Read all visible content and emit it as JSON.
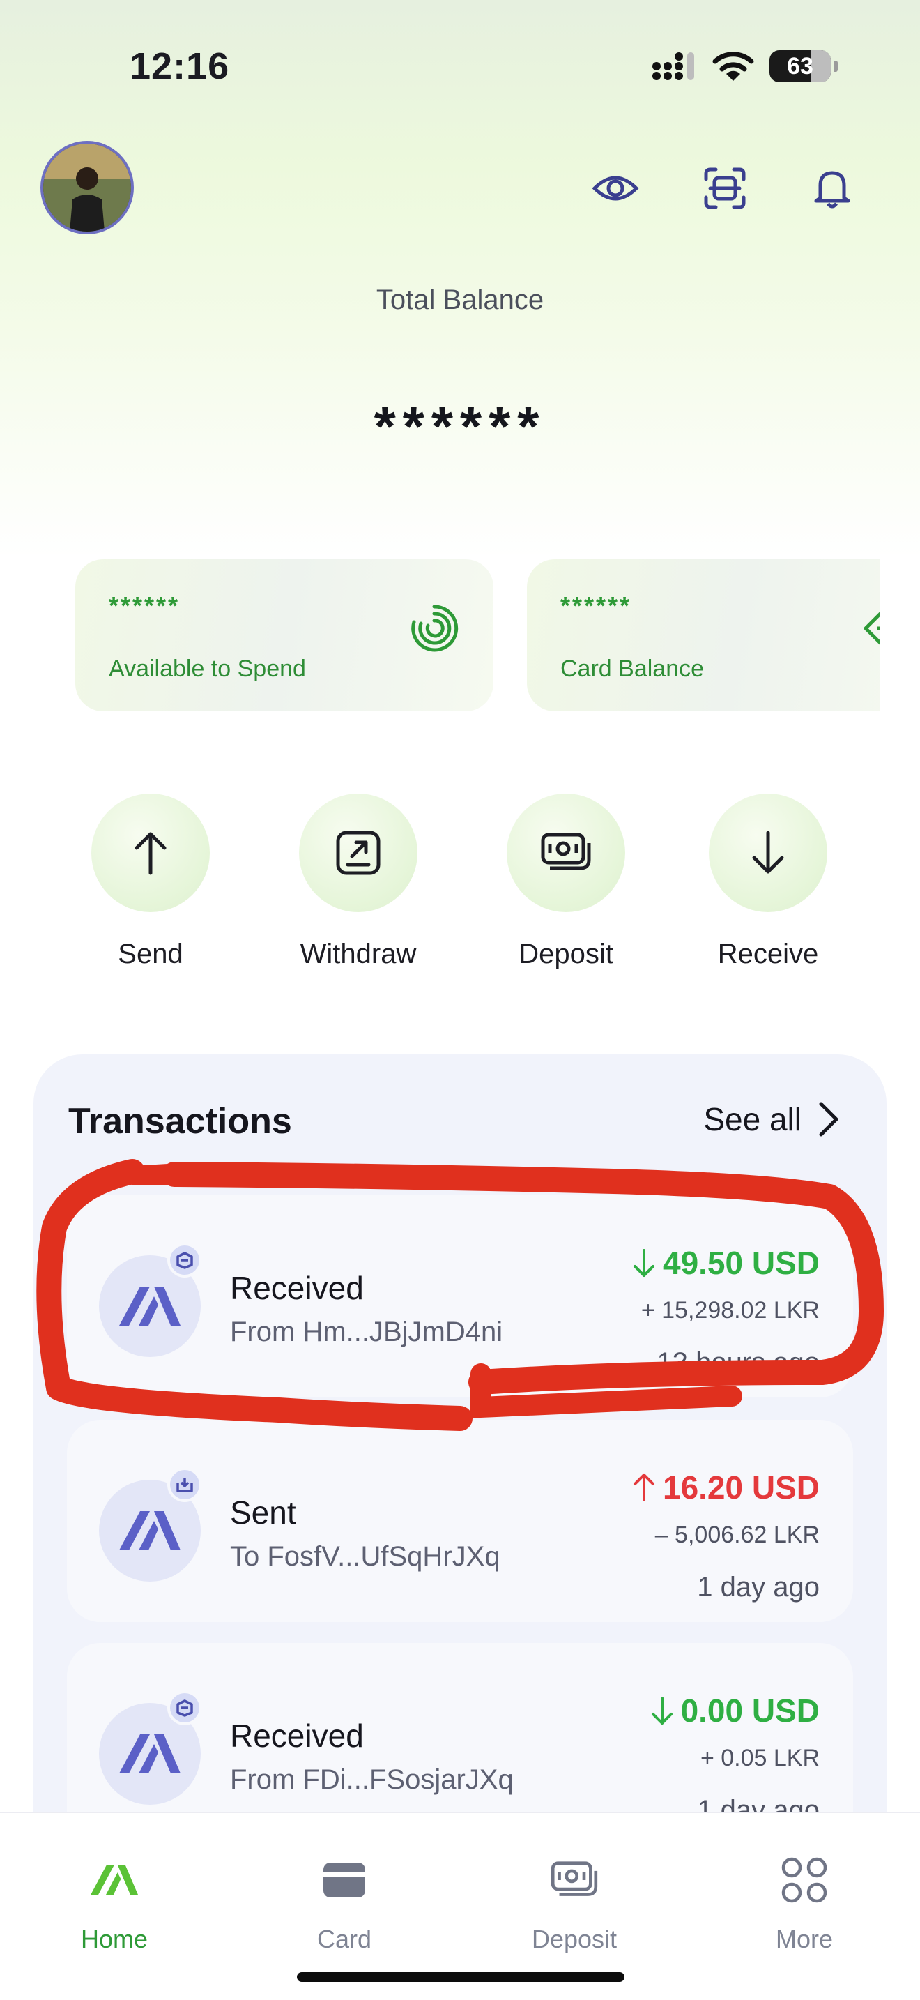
{
  "status_bar": {
    "time": "12:16",
    "battery": "63"
  },
  "header": {
    "total_balance_label": "Total Balance",
    "total_balance_value": "******"
  },
  "balance_cards": [
    {
      "value": "******",
      "label": "Available to Spend",
      "icon": "spend-ring-icon"
    },
    {
      "value": "******",
      "label": "Card Balance",
      "icon": "card-balance-icon"
    }
  ],
  "actions": [
    {
      "label": "Send",
      "icon": "arrow-up-icon"
    },
    {
      "label": "Withdraw",
      "icon": "withdraw-icon"
    },
    {
      "label": "Deposit",
      "icon": "cash-icon"
    },
    {
      "label": "Receive",
      "icon": "arrow-down-icon"
    }
  ],
  "transactions": {
    "title": "Transactions",
    "see_all": "See all",
    "items": [
      {
        "type": "Received",
        "party": "From Hm...JBjJmD4ni",
        "amount": "49.50 USD",
        "direction": "in",
        "lkr": "+ 15,298.02 LKR",
        "time": "13 hours ago"
      },
      {
        "type": "Sent",
        "party": "To FosfV...UfSqHrJXq",
        "amount": "16.20 USD",
        "direction": "out",
        "lkr": "– 5,006.62 LKR",
        "time": "1 day ago"
      },
      {
        "type": "Received",
        "party": "From FDi...FSosjarJXq",
        "amount": "0.00 USD",
        "direction": "in",
        "lkr": "+ 0.05 LKR",
        "time": "1 day ago"
      }
    ]
  },
  "tab_bar": [
    {
      "label": "Home",
      "active": true,
      "icon": "home-logo-icon"
    },
    {
      "label": "Card",
      "active": false,
      "icon": "card-icon"
    },
    {
      "label": "Deposit",
      "active": false,
      "icon": "cash-icon"
    },
    {
      "label": "More",
      "active": false,
      "icon": "grid-icon"
    }
  ],
  "colors": {
    "accent_green": "#2e9a37",
    "incoming_green": "#2faf43",
    "outgoing_red": "#e4393c",
    "brand_indigo": "#5b60c7",
    "annotation_red": "#e0301e"
  }
}
